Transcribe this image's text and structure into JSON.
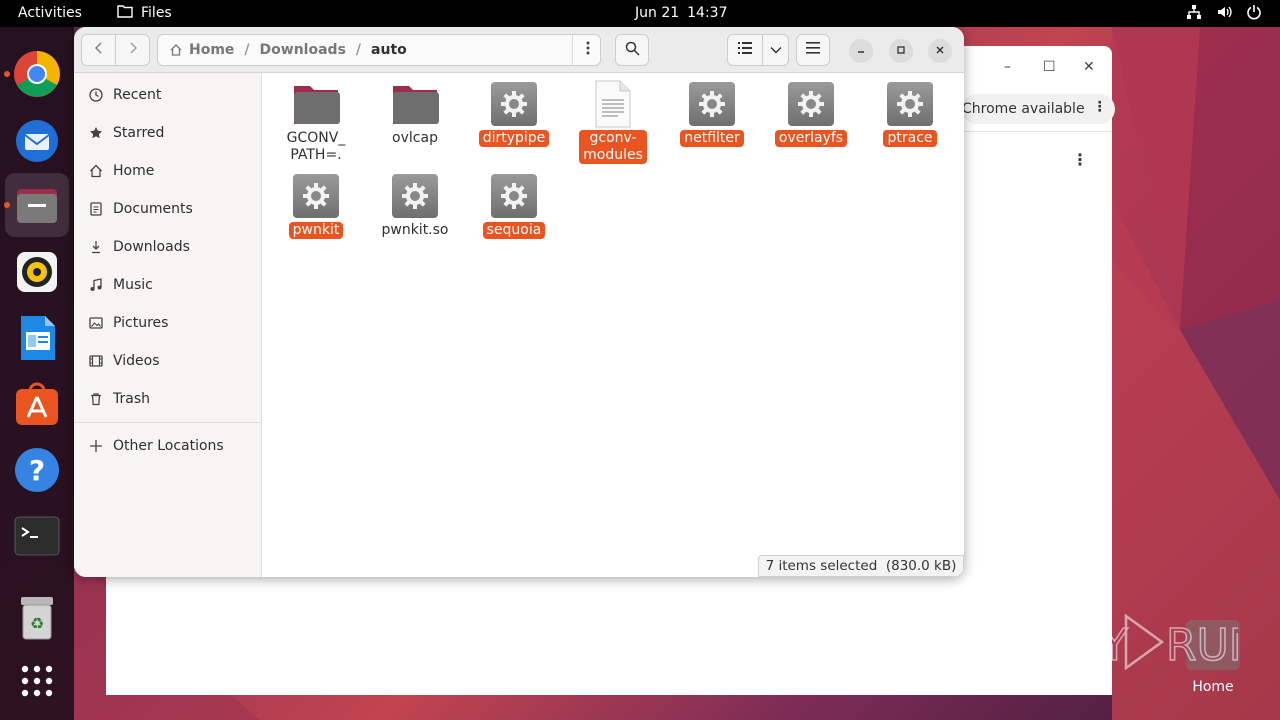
{
  "topbar": {
    "activities": "Activities",
    "app_name": "Files",
    "date": "Jun 21",
    "time": "14:37"
  },
  "dock": {
    "items": [
      "google-chrome",
      "thunderbird",
      "files",
      "rhythmbox",
      "libreoffice-writer",
      "ubuntu-software",
      "help",
      "terminal",
      "trash",
      "show-applications"
    ]
  },
  "chrome_window": {
    "notice": "Chrome available",
    "minimize": "–",
    "maximize": "☐",
    "close": "✕"
  },
  "files_window": {
    "breadcrumbs": [
      "Home",
      "Downloads",
      "auto"
    ],
    "sidebar": [
      {
        "label": "Recent",
        "icon": "clock-icon"
      },
      {
        "label": "Starred",
        "icon": "star-icon"
      },
      {
        "label": "Home",
        "icon": "home-icon"
      },
      {
        "label": "Documents",
        "icon": "document-icon"
      },
      {
        "label": "Downloads",
        "icon": "download-icon"
      },
      {
        "label": "Music",
        "icon": "music-icon"
      },
      {
        "label": "Pictures",
        "icon": "picture-icon"
      },
      {
        "label": "Videos",
        "icon": "video-icon"
      },
      {
        "label": "Trash",
        "icon": "trash-icon"
      },
      {
        "label": "Other Locations",
        "icon": "plus-icon"
      }
    ],
    "files": [
      {
        "name": "GCONV_\nPATH=.",
        "type": "folder",
        "selected": false
      },
      {
        "name": "ovlcap",
        "type": "folder",
        "selected": false
      },
      {
        "name": "dirtypipe",
        "type": "executable",
        "selected": true
      },
      {
        "name": "gconv-\nmodules",
        "type": "text",
        "selected": true
      },
      {
        "name": "netfilter",
        "type": "executable",
        "selected": true
      },
      {
        "name": "overlayfs",
        "type": "executable",
        "selected": true
      },
      {
        "name": "ptrace",
        "type": "executable",
        "selected": true
      },
      {
        "name": "pwnkit",
        "type": "executable",
        "selected": true
      },
      {
        "name": "pwnkit.so",
        "type": "executable",
        "selected": false
      },
      {
        "name": "sequoia",
        "type": "executable",
        "selected": true
      }
    ],
    "status": "7 items selected  (830.0 kB)"
  },
  "desktop": {
    "home_label": "Home",
    "watermark": "ANY RUN"
  },
  "colors": {
    "accent": "#e95420",
    "folder": "#6e6e6e",
    "folder_tab": "#9b2f4b"
  }
}
